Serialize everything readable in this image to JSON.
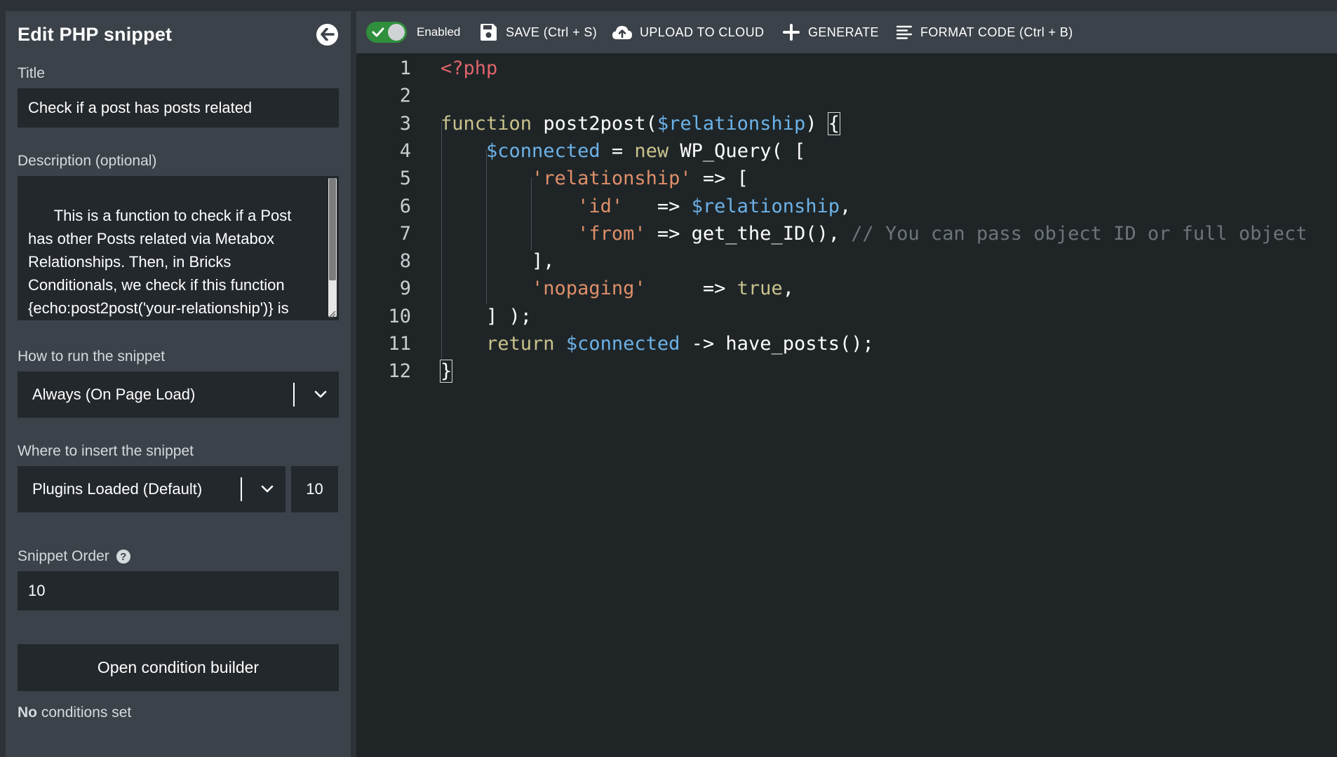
{
  "sidebar": {
    "title": "Edit PHP snippet",
    "back_icon": "arrow-left-icon",
    "title_field": {
      "label": "Title",
      "value": "Check if a post has posts related"
    },
    "description_field": {
      "label": "Description (optional)",
      "value": "This is a function to check if a Post has other Posts related via Metabox Relationships. Then, in Bricks Conditionals, we check if this function {echo:post2post('your-relationship')} is blank or not. In 'you-relationship'"
    },
    "run_field": {
      "label": "How to run the snippet",
      "value": "Always (On Page Load)"
    },
    "insert_field": {
      "label": "Where to insert the snippet",
      "value": "Plugins Loaded (Default)",
      "priority": "10"
    },
    "order_field": {
      "label": "Snippet Order",
      "value": "10"
    },
    "condition_button": "Open condition builder",
    "condition_status_bold": "No",
    "condition_status_rest": " conditions set"
  },
  "toolbar": {
    "enabled_label": "Enabled",
    "save_label": "SAVE (Ctrl + S)",
    "upload_label": "UPLOAD TO CLOUD",
    "generate_label": "GENERATE",
    "format_label": "FORMAT CODE (Ctrl + B)"
  },
  "editor": {
    "line_numbers": [
      "1",
      "2",
      "3",
      "4",
      "5",
      "6",
      "7",
      "8",
      "9",
      "10",
      "11",
      "12"
    ],
    "lines": [
      [
        {
          "t": "<?php",
          "c": "tag"
        }
      ],
      [],
      [
        {
          "t": "function ",
          "c": "kw"
        },
        {
          "t": "post2post(",
          "c": "plain"
        },
        {
          "t": "$relationship",
          "c": "var"
        },
        {
          "t": ") ",
          "c": "plain"
        },
        {
          "t": "{",
          "c": "bracket"
        }
      ],
      [
        {
          "t": "    ",
          "c": "plain"
        },
        {
          "t": "$connected",
          "c": "var"
        },
        {
          "t": " = ",
          "c": "plain"
        },
        {
          "t": "new",
          "c": "kw"
        },
        {
          "t": " WP_Query( [",
          "c": "plain"
        }
      ],
      [
        {
          "t": "        ",
          "c": "plain"
        },
        {
          "t": "'relationship'",
          "c": "str"
        },
        {
          "t": " => [",
          "c": "plain"
        }
      ],
      [
        {
          "t": "            ",
          "c": "plain"
        },
        {
          "t": "'id'",
          "c": "str"
        },
        {
          "t": "   => ",
          "c": "plain"
        },
        {
          "t": "$relationship",
          "c": "var"
        },
        {
          "t": ",",
          "c": "plain"
        }
      ],
      [
        {
          "t": "            ",
          "c": "plain"
        },
        {
          "t": "'from'",
          "c": "str"
        },
        {
          "t": " => get_the_ID(), ",
          "c": "plain"
        },
        {
          "t": "// You can pass object ID or full object",
          "c": "com"
        }
      ],
      [
        {
          "t": "        ],",
          "c": "plain"
        }
      ],
      [
        {
          "t": "        ",
          "c": "plain"
        },
        {
          "t": "'nopaging'",
          "c": "str"
        },
        {
          "t": "     => ",
          "c": "plain"
        },
        {
          "t": "true",
          "c": "kw"
        },
        {
          "t": ",",
          "c": "plain"
        }
      ],
      [
        {
          "t": "    ] );",
          "c": "plain"
        }
      ],
      [
        {
          "t": "    ",
          "c": "plain"
        },
        {
          "t": "return",
          "c": "kw"
        },
        {
          "t": " ",
          "c": "plain"
        },
        {
          "t": "$connected",
          "c": "var"
        },
        {
          "t": " -> have_posts();",
          "c": "plain"
        }
      ],
      [
        {
          "t": "}",
          "c": "bracket"
        }
      ]
    ]
  }
}
